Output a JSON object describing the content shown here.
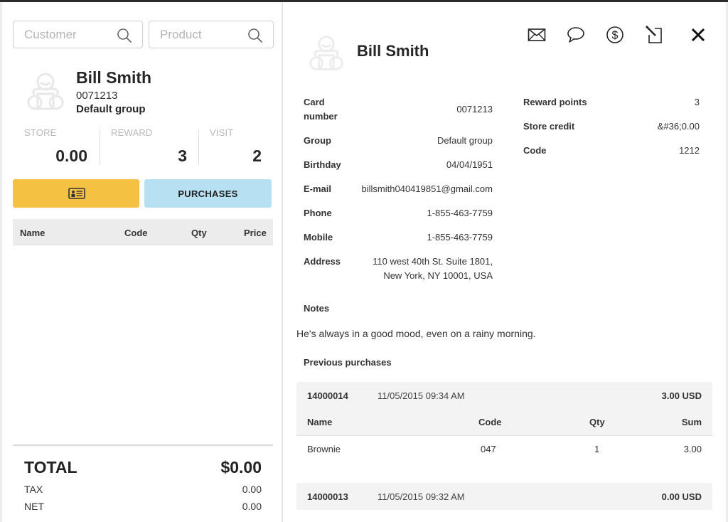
{
  "left_panel": {
    "customer_search": {
      "placeholder": "Customer",
      "value": "",
      "icon": "search-icon"
    },
    "product_search": {
      "placeholder": "Product",
      "value": "",
      "icon": "search-icon"
    },
    "customer": {
      "avatar": "baby-avatar-icon",
      "name": "Bill Smith",
      "card_number": "0071213",
      "group": "Default group"
    },
    "stats": [
      {
        "label": "STORE",
        "value": "0.00"
      },
      {
        "label": "REWARD",
        "value": "3"
      },
      {
        "label": "VISIT",
        "value": "2"
      }
    ],
    "buttons": {
      "card_icon": "id-card-icon",
      "purchases_label": "PURCHASES",
      "card_color": "#f4c143",
      "purchases_color": "#b8e0f3"
    },
    "cart_columns": [
      "Name",
      "Code",
      "Qty",
      "Price"
    ],
    "totals": {
      "total_label": "TOTAL",
      "total_value": "$0.00",
      "tax_label": "TAX",
      "tax_value": "0.00",
      "net_label": "NET",
      "net_value": "0.00"
    }
  },
  "right_panel": {
    "avatar": "baby-avatar-icon",
    "name": "Bill Smith",
    "actions": [
      {
        "name": "email",
        "icon": "envelope-icon"
      },
      {
        "name": "message",
        "icon": "speech-bubble-icon"
      },
      {
        "name": "payment",
        "icon": "dollar-circle-icon"
      },
      {
        "name": "edit",
        "icon": "edit-pencil-icon"
      },
      {
        "name": "close",
        "icon": "close-icon"
      }
    ],
    "details_left": [
      {
        "label": "Card number",
        "value": "0071213"
      },
      {
        "label": "Group",
        "value": "Default group"
      },
      {
        "label": "Birthday",
        "value": "04/04/1951"
      },
      {
        "label": "E-mail",
        "value": "billsmith040419851@gmail.com"
      },
      {
        "label": "Phone",
        "value": "1-855-463-7759"
      },
      {
        "label": "Mobile",
        "value": "1-855-463-7759"
      },
      {
        "label": "Address",
        "value": "110 west 40th St. Suite 1801,",
        "value2": "New York, NY 10001, USA"
      }
    ],
    "details_right": [
      {
        "label": "Reward points",
        "value": "3"
      },
      {
        "label": "Store credit",
        "value": "&#36;0.00"
      },
      {
        "label": "Code",
        "value": "1212"
      }
    ],
    "notes_label": "Notes",
    "notes_text": "He's always in a good mood, even on a rainy morning.",
    "previous_purchases_label": "Previous purchases",
    "purchases": [
      {
        "id": "14000014",
        "date": "11/05/2015 09:34 AM",
        "total": "3.00 USD",
        "columns": [
          "Name",
          "Code",
          "Qty",
          "Sum"
        ],
        "items": [
          {
            "name": "Brownie",
            "code": "047",
            "qty": "1",
            "sum": "3.00"
          }
        ]
      },
      {
        "id": "14000013",
        "date": "11/05/2015 09:32 AM",
        "total": "0.00 USD"
      }
    ]
  }
}
